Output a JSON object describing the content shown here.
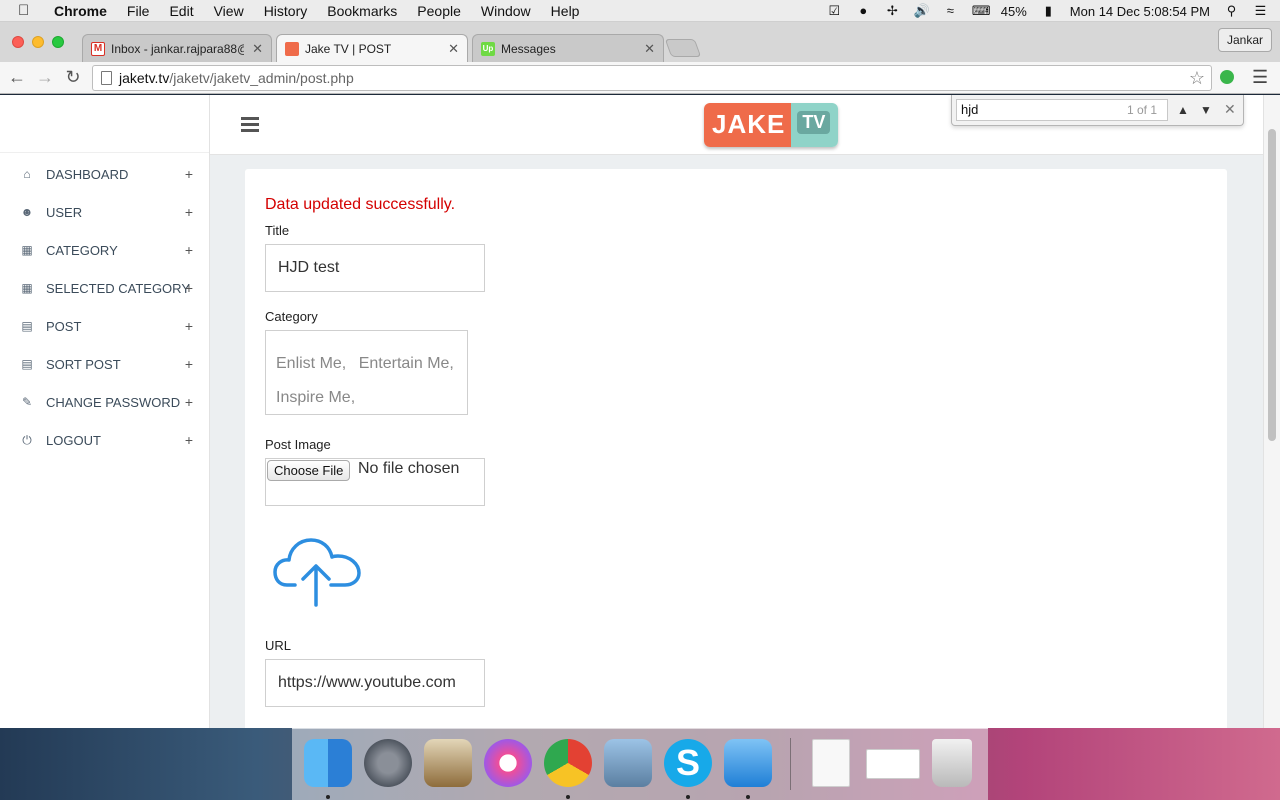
{
  "menubar": {
    "app": "Chrome",
    "items": [
      "File",
      "Edit",
      "View",
      "History",
      "Bookmarks",
      "People",
      "Window",
      "Help"
    ],
    "battery": "45%",
    "clock": "Mon 14 Dec  5:08:54 PM"
  },
  "tabs": [
    {
      "title": "Inbox - jankar.rajpara88@g",
      "favicon_color": "#d93025"
    },
    {
      "title": "Jake TV | POST",
      "favicon_color": "#ef6b4a"
    },
    {
      "title": "Messages",
      "favicon_color": "#6fda44"
    }
  ],
  "profile": "Jankar",
  "url": {
    "host": "jaketv.tv",
    "path": "/jaketv/jaketv_admin/post.php"
  },
  "find": {
    "query": "hjd",
    "count": "1 of 1"
  },
  "brand": {
    "part1": "JAKE",
    "part2": "TV"
  },
  "sidebar": {
    "items": [
      {
        "label": "DASHBOARD",
        "icon": "home-icon"
      },
      {
        "label": "USER",
        "icon": "users-icon"
      },
      {
        "label": "CATEGORY",
        "icon": "grid-icon"
      },
      {
        "label": "SELECTED CATEGORY",
        "icon": "grid-icon"
      },
      {
        "label": "POST",
        "icon": "list-icon"
      },
      {
        "label": "SORT POST",
        "icon": "list-icon"
      },
      {
        "label": "CHANGE PASSWORD",
        "icon": "edit-icon"
      },
      {
        "label": "LOGOUT",
        "icon": "power-icon"
      }
    ],
    "plus": "+"
  },
  "form": {
    "success": "Data updated successfully.",
    "title_label": "Title",
    "title_value": "HJD test",
    "category_label": "Category",
    "categories": [
      "Enlist Me,",
      "Entertain Me,",
      "Inspire Me,"
    ],
    "image_label": "Post Image",
    "choose_file": "Choose File",
    "no_file": "No file chosen",
    "url_label": "URL",
    "url_value": "https://www.youtube.com"
  },
  "colors": {
    "accent": "#2d8ee0",
    "success": "#d40000",
    "brand_orange": "#ef6b4a",
    "brand_teal": "#8fd3c8"
  }
}
